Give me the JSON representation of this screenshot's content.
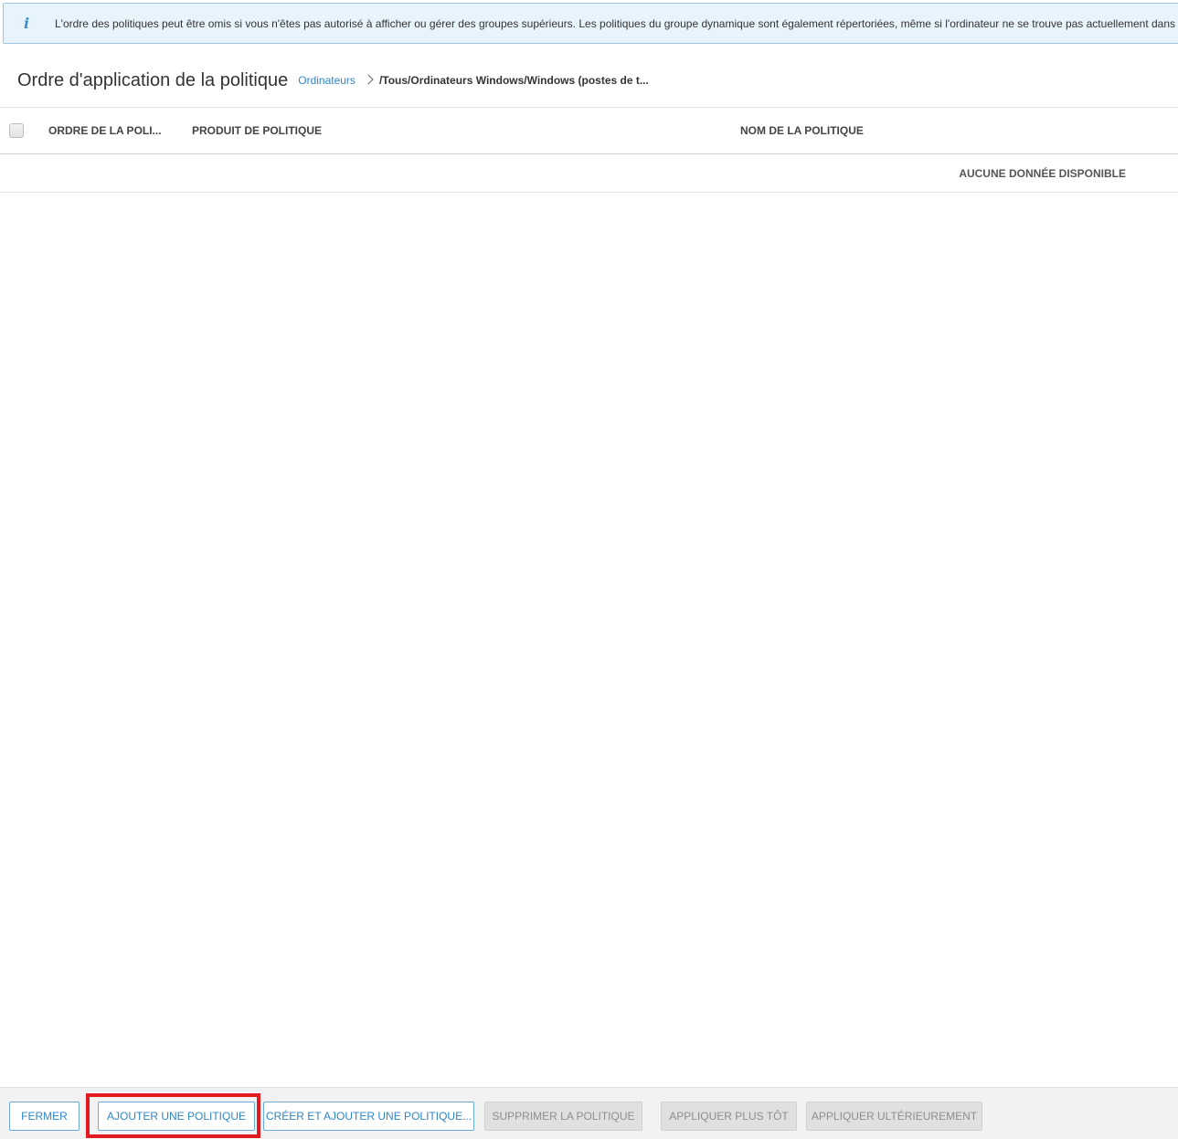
{
  "banner": {
    "icon": "info-icon",
    "text": "L'ordre des politiques peut être omis si vous n'êtes pas autorisé à afficher ou gérer des groupes supérieurs. Les politiques du groupe dynamique sont également répertoriées, même si l'ordinateur ne se trouve pas actuellement dans ce groupe."
  },
  "header": {
    "title": "Ordre d'application de la politique",
    "breadcrumb": {
      "link": "Ordinateurs",
      "path": "/Tous/Ordinateurs Windows/Windows (postes de t..."
    }
  },
  "table": {
    "columns": [
      "ORDRE DE LA POLI...",
      "PRODUIT DE POLITIQUE",
      "NOM DE LA POLITIQUE"
    ],
    "empty_message": "AUCUNE DONNÉE DISPONIBLE"
  },
  "footer": {
    "buttons": {
      "close": "FERMER",
      "add": "AJOUTER UNE POLITIQUE",
      "create_add": "CRÉER ET AJOUTER UNE POLITIQUE...",
      "delete": "SUPPRIMER LA POLITIQUE",
      "apply_earlier": "APPLIQUER PLUS TÔT",
      "apply_later": "APPLIQUER ULTÉRIEUREMENT"
    }
  },
  "colors": {
    "accent": "#2f86c5",
    "highlight": "#e21b23",
    "banner_bg": "#e8f4fb"
  }
}
